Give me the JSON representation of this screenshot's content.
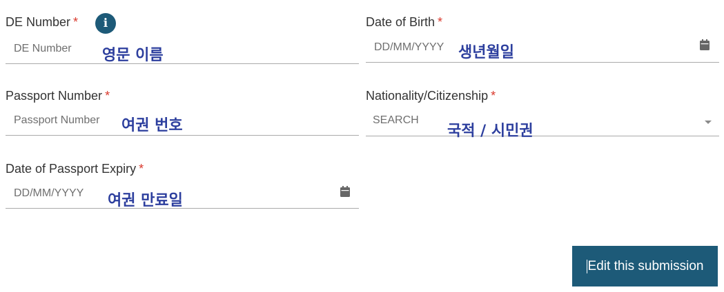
{
  "fields": {
    "de_number": {
      "label": "DE Number",
      "required_mark": "*",
      "placeholder": "DE Number",
      "note": "영문 이름"
    },
    "date_of_birth": {
      "label": "Date of Birth",
      "required_mark": "*",
      "placeholder": "DD/MM/YYYY",
      "note": "생년월일"
    },
    "passport_number": {
      "label": "Passport Number",
      "required_mark": "*",
      "placeholder": "Passport Number",
      "note": "여권 번호"
    },
    "nationality": {
      "label": "Nationality/Citizenship",
      "required_mark": "*",
      "placeholder": "SEARCH",
      "note": "국적 / 시민권"
    },
    "passport_expiry": {
      "label": "Date of Passport Expiry",
      "required_mark": "*",
      "placeholder": "DD/MM/YYYY",
      "note": "여권 만료일"
    }
  },
  "info_icon_glyph": "i",
  "edit_button": {
    "label": "Edit this submission"
  },
  "colors": {
    "accent": "#1d5a78",
    "required": "#d9382c",
    "annotation": "#2d3f9e",
    "underline": "#a9a9a9"
  }
}
